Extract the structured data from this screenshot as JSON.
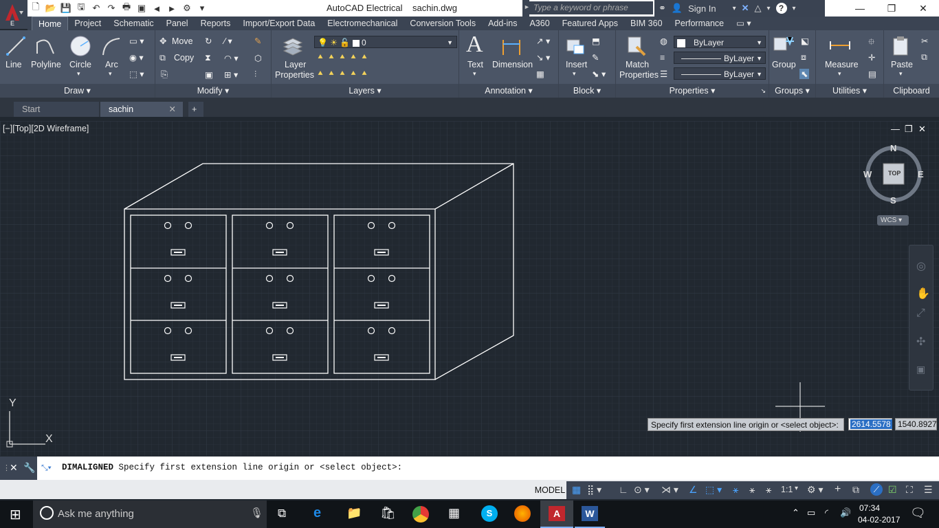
{
  "app": {
    "title": "AutoCAD Electrical",
    "filename": "sachin.dwg",
    "logo_letter": "E",
    "search_placeholder": "Type a keyword or phrase",
    "sign_in": "Sign In"
  },
  "ribbon_tabs": [
    "Home",
    "Project",
    "Schematic",
    "Panel",
    "Reports",
    "Import/Export Data",
    "Electromechanical",
    "Conversion Tools",
    "Add-ins",
    "A360",
    "Featured Apps",
    "BIM 360",
    "Performance"
  ],
  "draw": {
    "line": "Line",
    "polyline": "Polyline",
    "circle": "Circle",
    "arc": "Arc",
    "title": "Draw"
  },
  "modify": {
    "move": "Move",
    "copy": "Copy",
    "title": "Modify"
  },
  "layers": {
    "properties_line1": "Layer",
    "properties_line2": "Properties",
    "current_layer": "0",
    "title": "Layers"
  },
  "annotation": {
    "text": "Text",
    "dimension": "Dimension",
    "title": "Annotation"
  },
  "block": {
    "insert": "Insert",
    "title": "Block"
  },
  "properties": {
    "match_line1": "Match",
    "match_line2": "Properties",
    "color": "ByLayer",
    "linetype": "ByLayer",
    "lineweight": "ByLayer",
    "title": "Properties"
  },
  "groups": {
    "group": "Group",
    "title": "Groups"
  },
  "utilities": {
    "measure": "Measure",
    "title": "Utilities"
  },
  "clipboard": {
    "paste": "Paste",
    "title": "Clipboard"
  },
  "doc_tabs": {
    "start": "Start",
    "current": "sachin"
  },
  "viewport": {
    "label": "[−][Top][2D Wireframe]",
    "compass": {
      "n": "N",
      "s": "S",
      "e": "E",
      "w": "W",
      "top": "TOP"
    },
    "wcs": "WCS",
    "ucs": {
      "x": "X",
      "y": "Y"
    }
  },
  "tooltip": {
    "prompt": "Specify first extension line origin or <select object>:",
    "x_value": "2614.5578",
    "y_value": "1540.8927"
  },
  "command": {
    "name": "DIMALIGNED",
    "prompt": "Specify first extension line origin or <select object>:"
  },
  "status": {
    "model": "MODEL",
    "scale": "1:1"
  },
  "taskbar": {
    "search": "Ask me anything",
    "time": "07:34",
    "date": "04-02-2017"
  },
  "colors": {
    "accent": "#3b99d9",
    "background": "#212830",
    "ribbon": "#4b5566",
    "drawing": "#ffffff",
    "autocad_red": "#c1272d"
  }
}
